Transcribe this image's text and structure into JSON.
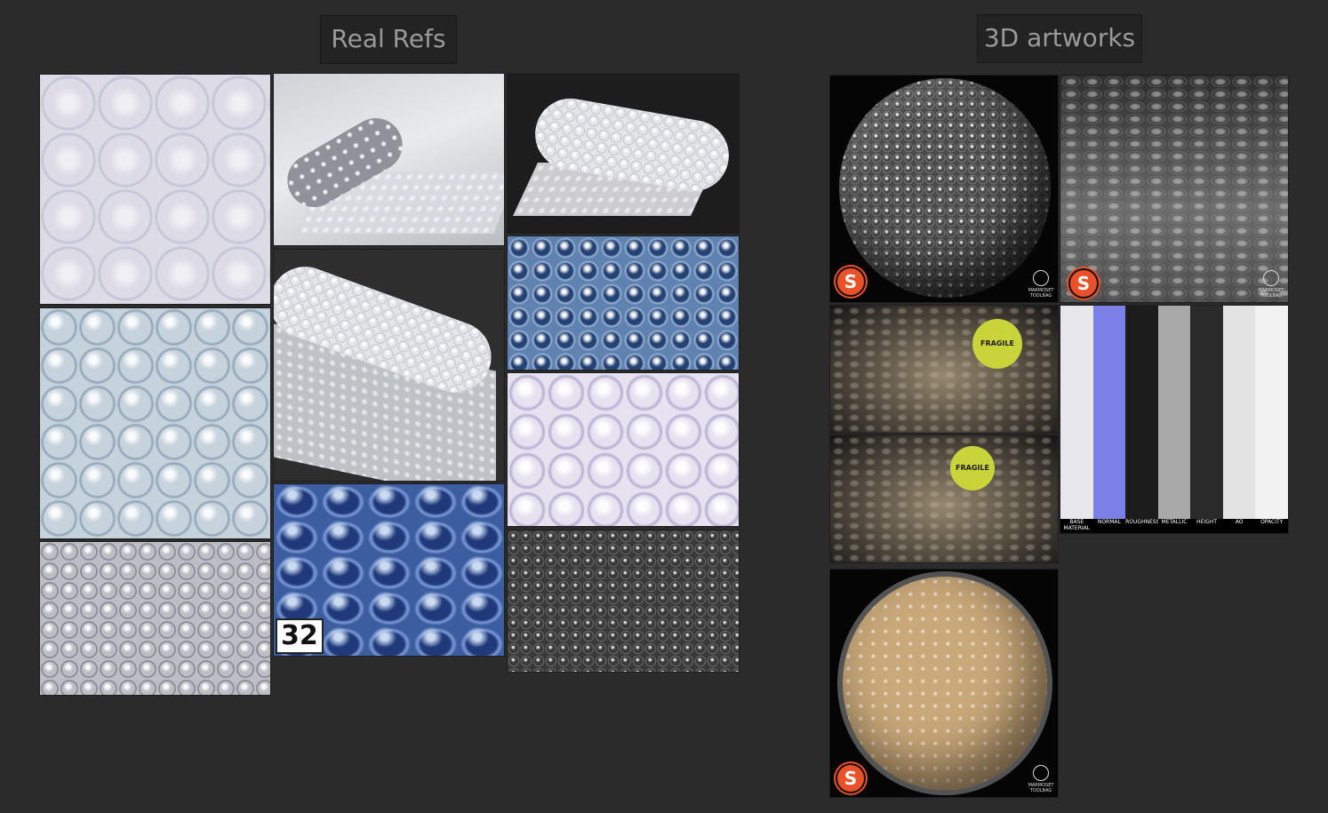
{
  "headers": {
    "real_refs": "Real Refs",
    "artworks_3d": "3D artworks"
  },
  "badges": {
    "number": "32"
  },
  "logos": {
    "substance": "S",
    "marmoset_line1": "MARMOSET",
    "marmoset_line2": "TOOLBAG"
  },
  "scene_text": {
    "sticker": "FRAGILE"
  },
  "maps": [
    {
      "label": "BASE MATERIAL",
      "color": "#e8e8ec"
    },
    {
      "label": "NORMAL",
      "color": "#7b7fe6"
    },
    {
      "label": "ROUGHNESS",
      "color": "#1c1c1c"
    },
    {
      "label": "METALLIC",
      "color": "#a9a9a9"
    },
    {
      "label": "HEIGHT",
      "color": "#2a2a2a"
    },
    {
      "label": "AO",
      "color": "#e3e3e3"
    },
    {
      "label": "OPACITY",
      "color": "#f2f2f2"
    }
  ],
  "colors": {
    "background": "#2b2b2b",
    "header_bg": "#232323",
    "substance": "#e8512a"
  }
}
